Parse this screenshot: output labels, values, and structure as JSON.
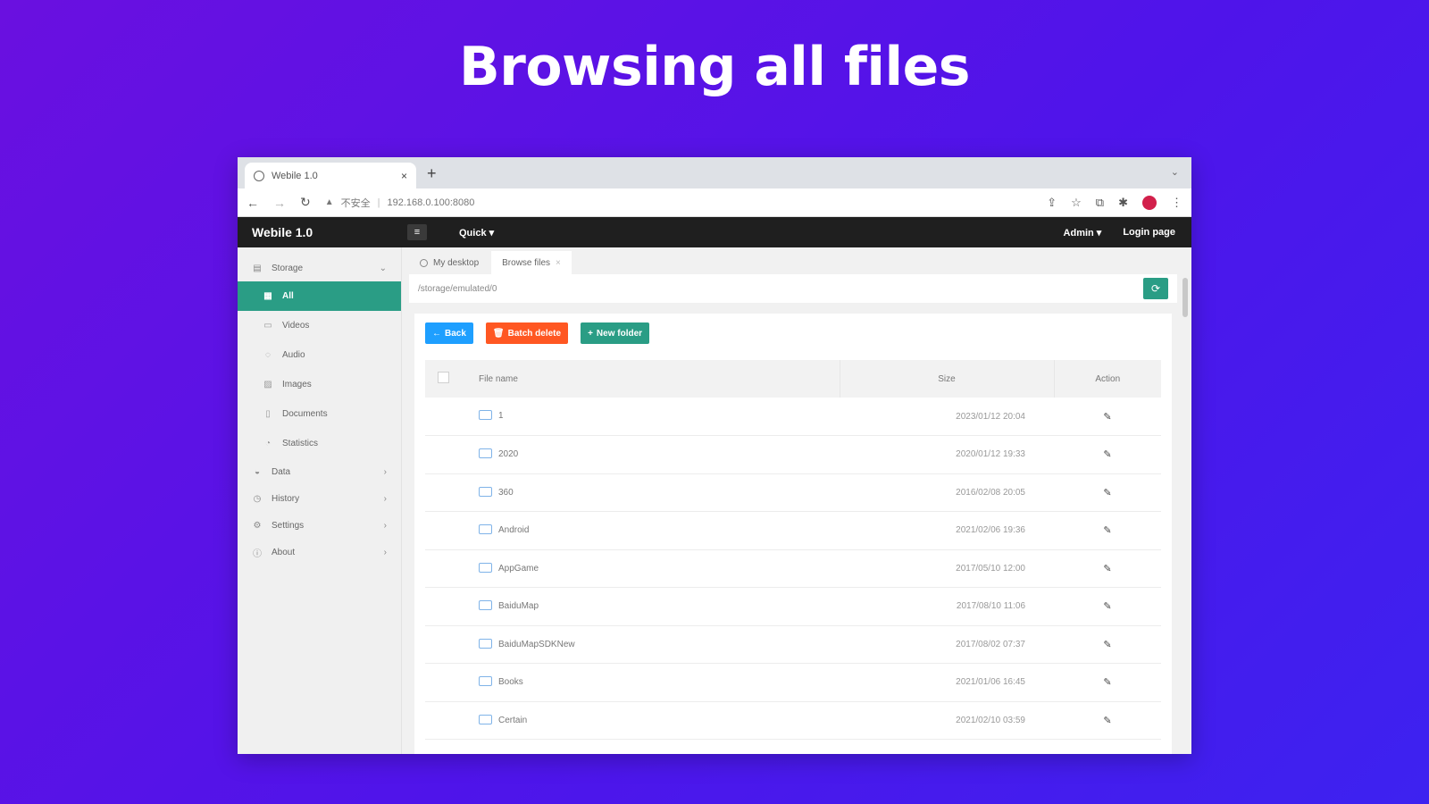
{
  "headline": "Browsing all files",
  "browser": {
    "tab_title": "Webile 1.0",
    "tab_close": "×",
    "new_tab": "+",
    "address_warning": "不安全",
    "address_url": "192.168.0.100:8080"
  },
  "app": {
    "brand": "Webile 1.0",
    "quick_menu": "Quick ▾",
    "admin_menu": "Admin ▾",
    "login_page": "Login page"
  },
  "sidebar": {
    "storage": "Storage",
    "items": [
      "All",
      "Videos",
      "Audio",
      "Images",
      "Documents",
      "Statistics"
    ],
    "groups": [
      "Data",
      "History",
      "Settings",
      "About"
    ]
  },
  "page_tabs": [
    "My desktop",
    "Browse files"
  ],
  "path": "/storage/emulated/0",
  "buttons": {
    "back": "Back",
    "batch_delete": "Batch delete",
    "new_folder": "New folder"
  },
  "table": {
    "headers": [
      "File name",
      "Size",
      "Action"
    ],
    "rows": [
      {
        "name": "1",
        "date": "2023/01/12 20:04"
      },
      {
        "name": "2020",
        "date": "2020/01/12 19:33"
      },
      {
        "name": "360",
        "date": "2016/02/08 20:05"
      },
      {
        "name": "Android",
        "date": "2021/02/06 19:36"
      },
      {
        "name": "AppGame",
        "date": "2017/05/10 12:00"
      },
      {
        "name": "BaiduMap",
        "date": "2017/08/10 11:06"
      },
      {
        "name": "BaiduMapSDKNew",
        "date": "2017/08/02 07:37"
      },
      {
        "name": "Books",
        "date": "2021/01/06 16:45"
      },
      {
        "name": "Certain",
        "date": "2021/02/10 03:59"
      }
    ]
  },
  "colors": {
    "accent_green": "#2a9d85",
    "back_blue": "#1e9fff",
    "delete_orange": "#ff5722",
    "background_purple": "#5a12e6"
  }
}
